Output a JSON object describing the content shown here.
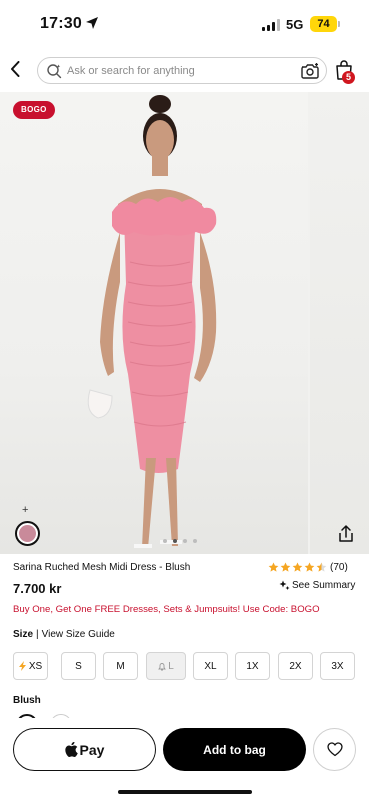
{
  "status_bar": {
    "time": "17:30",
    "network": "5G",
    "battery": "74"
  },
  "search": {
    "placeholder": "Ask or search for anything"
  },
  "cart": {
    "count": "5"
  },
  "gallery": {
    "badge": "BOGO",
    "swatch_add": "+",
    "swatch_color": "#c98a9a",
    "dot_count": 4,
    "active_dot": 1
  },
  "product": {
    "title": "Sarina Ruched Mesh Midi Dress - Blush",
    "price": "7.700 kr",
    "rating_stars": 4.5,
    "rating_count": "(70)",
    "summary_label": "See Summary",
    "promo": "Buy One, Get One FREE Dresses, Sets & Jumpsuits! Use Code: BOGO"
  },
  "size_section": {
    "label": "Size",
    "divider": "|",
    "guide_link": "View Size Guide",
    "options": [
      {
        "label": "XS",
        "icon": "lightning-icon",
        "disabled": false
      },
      {
        "label": "S",
        "disabled": false
      },
      {
        "label": "M",
        "disabled": false
      },
      {
        "label": "L",
        "icon": "bell-icon",
        "disabled": true
      },
      {
        "label": "XL",
        "disabled": false
      },
      {
        "label": "1X",
        "disabled": false
      },
      {
        "label": "2X",
        "disabled": false
      },
      {
        "label": "3X",
        "disabled": false
      }
    ]
  },
  "color_section": {
    "label": "Blush"
  },
  "actions": {
    "apple_pay": "Pay",
    "add_to_bag": "Add to bag"
  },
  "colors": {
    "accent_red": "#c8102e",
    "star": "#f5a623",
    "battery": "#ffd60a"
  }
}
